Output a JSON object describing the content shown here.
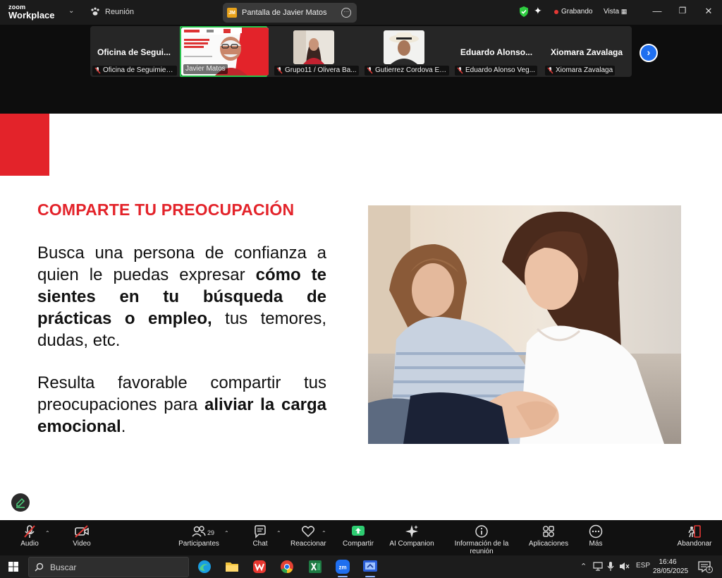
{
  "titlebar": {
    "brand_line1": "zoom",
    "brand_line2": "Workplace",
    "meeting_label": "Reunión",
    "share_initials": "JM",
    "share_label": "Pantalla de Javier Matos",
    "recording_label": "Grabando",
    "view_label": "Vista"
  },
  "participants": [
    {
      "big_name": "Oficina de Segui...",
      "label": "Oficina de Seguimien...",
      "muted": true
    },
    {
      "big_name": "",
      "label": "Javier Matos",
      "muted": false,
      "active": true,
      "has_video": true
    },
    {
      "big_name": "",
      "label": "Grupo11 / Olivera Ba...",
      "muted": true,
      "has_video": true
    },
    {
      "big_name": "",
      "label": "Gutierrez Cordova Ed...",
      "muted": true,
      "has_video": true
    },
    {
      "big_name": "Eduardo  Alonso...",
      "label": "Eduardo Alonso Veg...",
      "muted": true
    },
    {
      "big_name": "Xiomara Zavalaga",
      "label": "Xiomara Zavalaga",
      "muted": true
    }
  ],
  "slide": {
    "title": "COMPARTE TU PREOCUPACIÓN",
    "p1_a": "Busca una persona de confianza  a quien le puedas expresar ",
    "p1_b": "cómo te sientes en tu búsqueda de prácticas o empleo,",
    "p1_c": " tus temores, dudas, etc.",
    "p2_a": "Resulta favorable compartir tus preocupaciones para ",
    "p2_b": "aliviar la carga emocional",
    "p2_c": "."
  },
  "toolbar": {
    "audio": "Audio",
    "video": "Video",
    "participants": "Participantes",
    "participants_count": "29",
    "chat": "Chat",
    "react": "Reaccionar",
    "share": "Compartir",
    "ai": "AI Companion",
    "info": "Información de la reunión",
    "apps": "Aplicaciones",
    "more": "Más",
    "leave": "Abandonar"
  },
  "taskbar": {
    "search_placeholder": "Buscar",
    "lang": "ESP",
    "time": "16:46",
    "date": "28/05/2025",
    "notif_count": "1"
  },
  "colors": {
    "accent_red": "#e3232a",
    "zoom_blue": "#1f6ff0",
    "active_green": "#27c24c",
    "share_green": "#2ecc71"
  }
}
